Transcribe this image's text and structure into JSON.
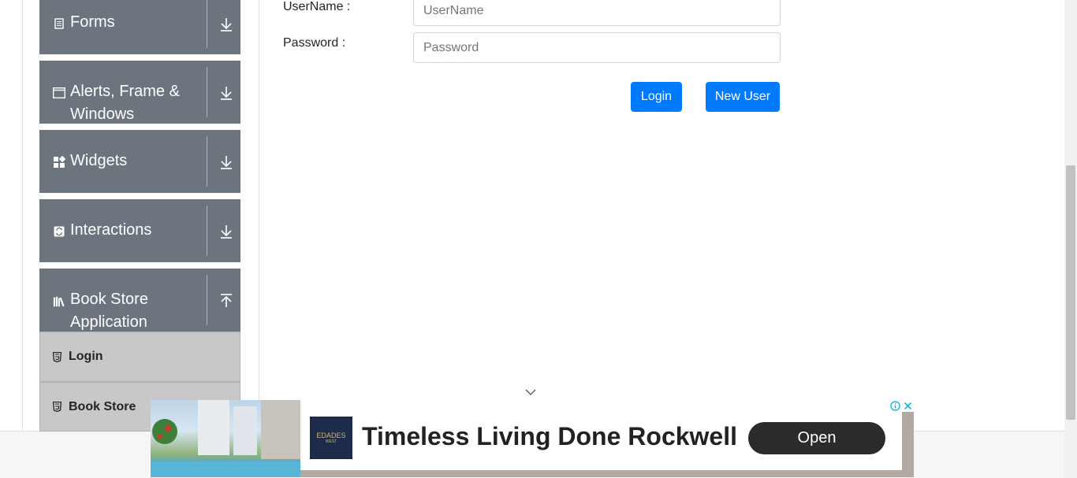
{
  "sidebar": {
    "groups": [
      {
        "label": "Forms",
        "icon": "form-icon",
        "arrow": "arrow-down-icon"
      },
      {
        "label": "Alerts, Frame &",
        "label2": "Windows",
        "icon": "window-icon",
        "arrow": "arrow-down-icon"
      },
      {
        "label": "Widgets",
        "icon": "widgets-icon",
        "arrow": "arrow-down-icon"
      },
      {
        "label": "Interactions",
        "icon": "interactions-icon",
        "arrow": "arrow-down-icon"
      },
      {
        "label": "Book Store",
        "label2": "Application",
        "icon": "books-icon",
        "arrow": "arrow-up-icon"
      }
    ],
    "subitems": [
      {
        "label": "Login",
        "icon": "html5-icon"
      },
      {
        "label": "Book Store",
        "icon": "html5-icon"
      }
    ]
  },
  "form": {
    "username_label": "UserName :",
    "username_placeholder": "UserName",
    "password_label": "Password :",
    "password_placeholder": "Password",
    "login_button": "Login",
    "new_user_button": "New User"
  },
  "ad": {
    "logo_line1": "EDADES",
    "logo_line2": "WEST",
    "headline": "Timeless Living Done Rockwell",
    "cta": "Open"
  },
  "colors": {
    "sidebar_bg": "#6c757d",
    "primary": "#007bff",
    "subitem_bg": "#c8c8c8"
  }
}
